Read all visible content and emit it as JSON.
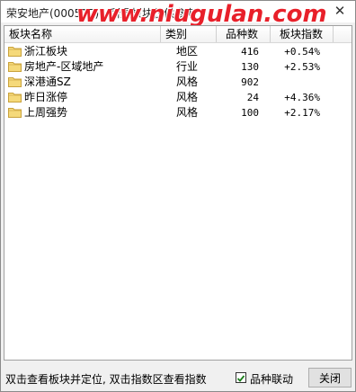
{
  "window": {
    "title": "荣安地产(000517) - 所属板块仅供参考",
    "watermark": "www.niugulan.com"
  },
  "table": {
    "columns": [
      "板块名称",
      "类别",
      "品种数",
      "板块指数"
    ],
    "rows": [
      {
        "name": "浙江板块",
        "category": "地区",
        "count": "416",
        "index": "+0.54%"
      },
      {
        "name": "房地产-区域地产",
        "category": "行业",
        "count": "130",
        "index": "+2.53%"
      },
      {
        "name": "深港通SZ",
        "category": "风格",
        "count": "902",
        "index": ""
      },
      {
        "name": "昨日涨停",
        "category": "风格",
        "count": "24",
        "index": "+4.36%"
      },
      {
        "name": "上周强势",
        "category": "风格",
        "count": "100",
        "index": "+2.17%"
      }
    ]
  },
  "footer": {
    "hint": "双击查看板块并定位, 双击指数区查看指数",
    "link_label": "品种联动",
    "link_checked": true,
    "close_label": "关闭"
  },
  "colors": {
    "watermark": "#e8202a",
    "folder_fill": "#f5d97a",
    "folder_stroke": "#c9a23c",
    "check": "#1a7f1a"
  }
}
